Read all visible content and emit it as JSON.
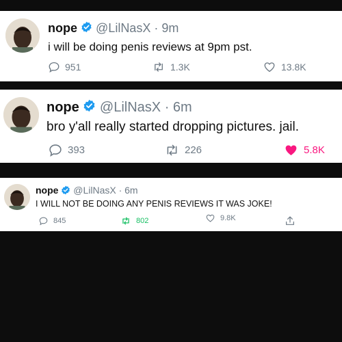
{
  "tweets": [
    {
      "name": "nope",
      "handle": "@LilNasX",
      "separator": "·",
      "time": "9m",
      "text": "i will be doing penis reviews at 9pm pst.",
      "replies": "951",
      "retweets": "1.3K",
      "likes": "13.8K",
      "liked": false,
      "retweeted": false
    },
    {
      "name": "nope",
      "handle": "@LilNasX",
      "separator": "·",
      "time": "6m",
      "text": "bro y'all really started dropping pictures. jail.",
      "replies": "393",
      "retweets": "226",
      "likes": "5.8K",
      "liked": true,
      "retweeted": false
    },
    {
      "name": "nope",
      "handle": "@LilNasX",
      "separator": "·",
      "time": "6m",
      "text": "I WILL NOT BE DOING ANY PENIS REVIEWS IT WAS JOKE!",
      "replies": "845",
      "retweets": "802",
      "likes": "9.8K",
      "liked": false,
      "retweeted": true
    }
  ],
  "icons": {
    "verified": "verified-badge-icon",
    "reply": "reply-icon",
    "retweet": "retweet-icon",
    "like": "heart-icon",
    "share": "share-icon"
  },
  "colors": {
    "verified_blue": "#1d9bf0",
    "like_red": "#f91880",
    "retweet_green": "#17bf63",
    "meta_gray": "#6e7a85",
    "band_black": "#0d0d0d"
  }
}
